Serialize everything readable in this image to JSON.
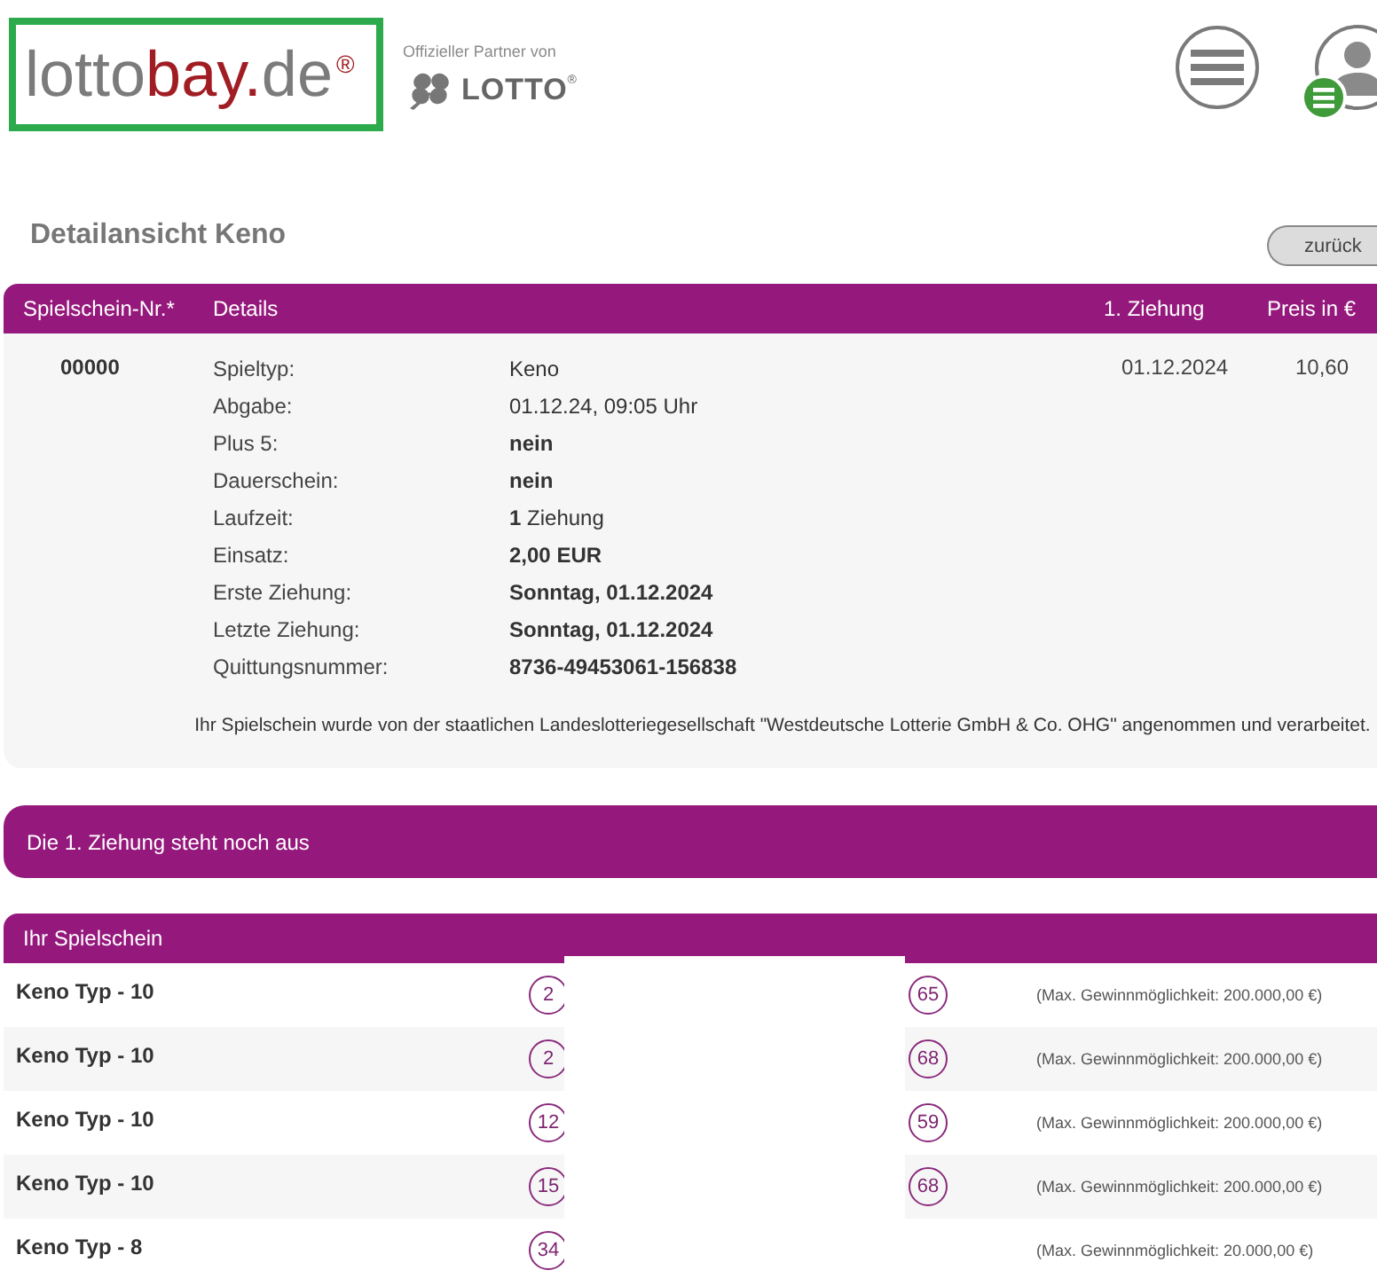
{
  "header": {
    "logo": {
      "segments": [
        {
          "text": "lotto",
          "color": "#7b7b7b"
        },
        {
          "text": "bay.",
          "color": "#a11d24"
        },
        {
          "text": "de",
          "color": "#7b7b7b"
        }
      ],
      "mark": "®"
    },
    "partner": {
      "caption": "Offizieller Partner von",
      "brand": "LOTTO",
      "mark": "®"
    }
  },
  "page_title": "Detailansicht Keno",
  "back_button": "zurück",
  "ticket_table": {
    "columns": [
      "Spielschein-Nr.*",
      "Details",
      "1. Ziehung",
      "Preis in €"
    ],
    "row": {
      "number": "00000",
      "details": [
        {
          "label": "Spieltyp:",
          "value": "Keno",
          "emphasis": false
        },
        {
          "label": "Abgabe:",
          "value": "01.12.24, 09:05 Uhr",
          "emphasis": false
        },
        {
          "label": "Plus 5:",
          "value": "nein",
          "emphasis": true
        },
        {
          "label": "Dauerschein:",
          "value": "nein",
          "emphasis": true
        },
        {
          "label": "Laufzeit:",
          "value": "**1** Ziehung",
          "emphasis": false
        },
        {
          "label": "Einsatz:",
          "value": "2,00 EUR",
          "emphasis": true
        },
        {
          "label": "Erste Ziehung:",
          "value": "Sonntag, 01.12.2024",
          "emphasis": true
        },
        {
          "label": "Letzte Ziehung:",
          "value": "Sonntag, 01.12.2024",
          "emphasis": true
        },
        {
          "label": "Quittungsnummer:",
          "value": "8736-49453061-156838",
          "emphasis": true
        }
      ],
      "first_draw": "01.12.2024",
      "price": "10,60"
    },
    "notice": "Ihr Spielschein wurde von der staatlichen Landeslotteriegesellschaft \"Westdeutsche Lotterie GmbH & Co. OHG\" angenommen und verarbeitet."
  },
  "status_banner": "Die 1. Ziehung steht noch aus",
  "slip": {
    "title": "Ihr Spielschein",
    "rows": [
      {
        "game": "Keno Typ - 10",
        "numbers": [
          "2",
          "65"
        ],
        "max_win": "(Max. Gewinnmöglichkeit: 200.000,00 €)"
      },
      {
        "game": "Keno Typ - 10",
        "numbers": [
          "2",
          "68"
        ],
        "max_win": "(Max. Gewinnmöglichkeit: 200.000,00 €)"
      },
      {
        "game": "Keno Typ - 10",
        "numbers": [
          "12",
          "59"
        ],
        "max_win": "(Max. Gewinnmöglichkeit: 200.000,00 €)"
      },
      {
        "game": "Keno Typ - 10",
        "numbers": [
          "15",
          "68"
        ],
        "max_win": "(Max. Gewinnmöglichkeit: 200.000,00 €)"
      },
      {
        "game": "Keno Typ - 8",
        "numbers": [
          "34"
        ],
        "max_win": "(Max. Gewinnmöglichkeit: 20.000,00 €)"
      }
    ]
  }
}
